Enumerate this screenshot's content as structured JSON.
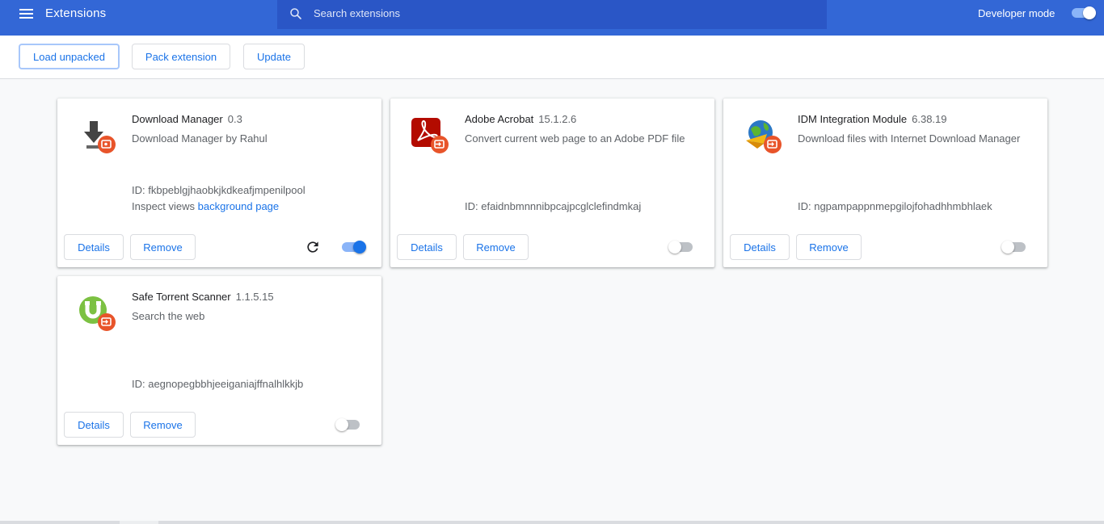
{
  "header": {
    "title": "Extensions",
    "search_placeholder": "Search extensions",
    "developer_mode_label": "Developer mode",
    "developer_mode_on": true
  },
  "toolbar": {
    "load_unpacked": "Load unpacked",
    "pack_extension": "Pack extension",
    "update": "Update"
  },
  "colors": {
    "header_bg": "#3367d6",
    "accent": "#1a73e8",
    "page_bg": "#f8f9fa"
  },
  "extensions": [
    {
      "name": "Download Manager",
      "version": "0.3",
      "description": "Download Manager by Rahul",
      "id_text": "ID: fkbpeblgjhaobkjkdkeafjmpenilpool",
      "inspect_label": "Inspect views",
      "inspect_link": "background page",
      "details": "Details",
      "remove": "Remove",
      "enabled": true,
      "icon": "download-arrow-icon"
    },
    {
      "name": "Adobe Acrobat",
      "version": "15.1.2.6",
      "description": "Convert current web page to an Adobe PDF file",
      "id_text": "ID: efaidnbmnnnibpcajpcglclefindmkaj",
      "details": "Details",
      "remove": "Remove",
      "enabled": false,
      "icon": "adobe-acrobat-icon"
    },
    {
      "name": "IDM Integration Module",
      "version": "6.38.19",
      "description": "Download files with Internet Download Manager",
      "id_text": "ID: ngpampappnmepgilojfohadhhmbhlaek",
      "details": "Details",
      "remove": "Remove",
      "enabled": false,
      "icon": "idm-globe-icon"
    },
    {
      "name": "Safe Torrent Scanner",
      "version": "1.1.5.15",
      "description": "Search the web",
      "id_text": "ID: aegnopegbbhjeeiganiajffnalhlkkjb",
      "details": "Details",
      "remove": "Remove",
      "enabled": false,
      "icon": "torrent-magnet-icon"
    }
  ]
}
